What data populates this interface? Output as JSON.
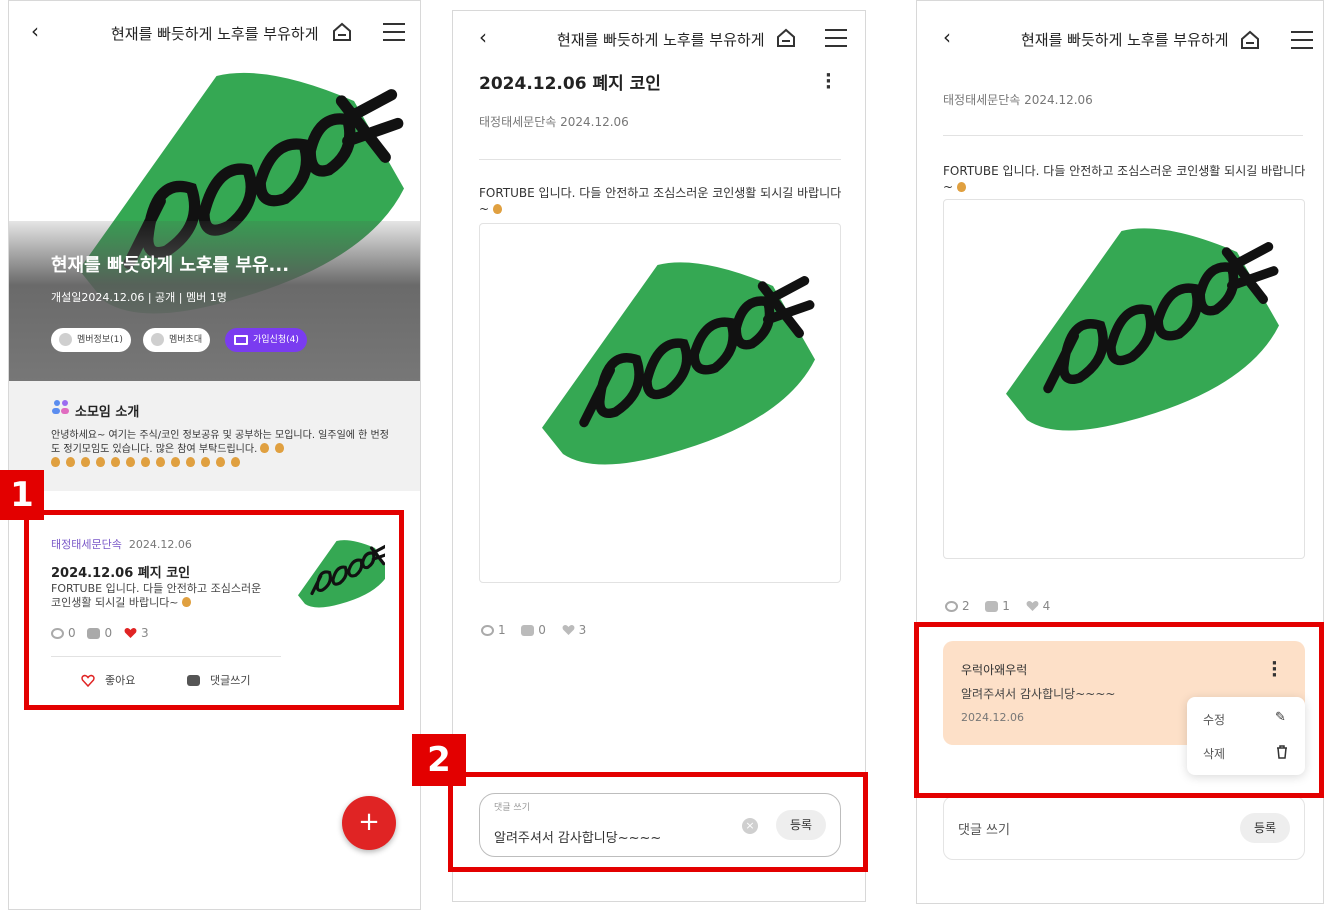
{
  "header": {
    "title": "현재를 빠듯하게 노후를 부유하게",
    "back_icon": "chevron-left-icon",
    "home_icon": "home-icon",
    "menu_icon": "hamburger-menu-icon"
  },
  "colors": {
    "accent_red": "#e30000",
    "purple": "#7a3cf0",
    "fab": "#e02424",
    "reply_bg": "#fde0c8"
  },
  "panel1": {
    "hero_title": "현재를 빠듯하게 노후를 부유...",
    "hero_meta": "개설일2024.12.06 | 공개 | 멤버 1명",
    "chips": [
      "멤버정보(1)",
      "멤버초대",
      "가입신청(4)"
    ],
    "intro_title": "소모임 소개",
    "intro_text": "안녕하세요~ 여기는 주식/코인 정보공유 및 공부하는 모입니다. 일주일에 한 번정도 정기모임도 있습니다. 많은 참여 부탁드립니다.",
    "post": {
      "author": "태정태세문단속",
      "date": "2024.12.06",
      "title": "2024.12.06 폐지 코인",
      "body": "FORTUBE 입니다. 다들 안전하고 조심스러운 코인생활 되시길 바랍니다~",
      "views": "0",
      "comments": "0",
      "likes": "3",
      "like_label": "좋아요",
      "comment_label": "댓글쓰기"
    },
    "fab_label": "+",
    "step_number": "1"
  },
  "panel2": {
    "title": "2024.12.06 폐지 코인",
    "author_line": "태정태세문단속 2024.12.06",
    "body": "FORTUBE 입니다. 다들 안전하고 조심스러운 코인생활 되시길 바랍니다~",
    "views": "1",
    "comments": "0",
    "likes": "3",
    "comment_label": "댓글 쓰기",
    "comment_value": "알려주셔서 감사합니당~~~~",
    "submit_label": "등록",
    "step_number": "2"
  },
  "panel3": {
    "author_line": "태정태세문단속 2024.12.06",
    "body": "FORTUBE 입니다. 다들 안전하고 조심스러운 코인생활 되시길 바랍니다~",
    "views": "2",
    "comments": "1",
    "likes": "4",
    "reply": {
      "name": "우럭아왜우럭",
      "text": "알려주셔서 감사합니당~~~~",
      "date": "2024.12.06"
    },
    "menu_items": [
      "수정",
      "삭제"
    ],
    "comment_placeholder": "댓글 쓰기",
    "submit_label": "등록"
  },
  "image_text": "10000₩"
}
